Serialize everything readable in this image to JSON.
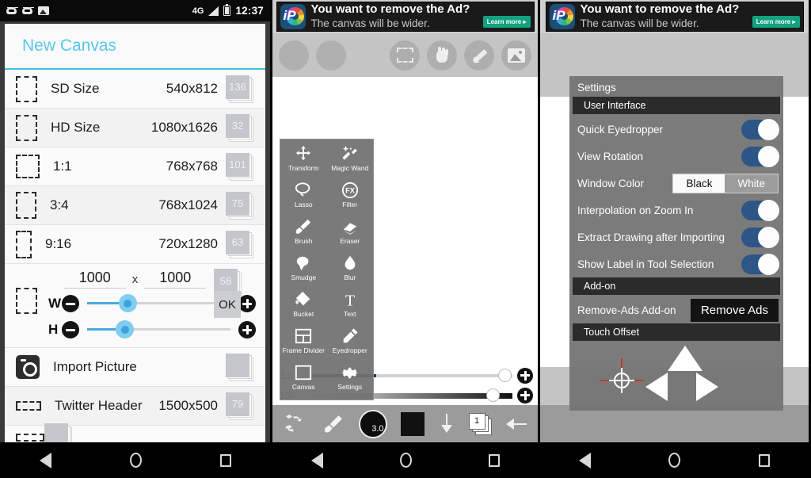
{
  "statusbar": {
    "network": "4G",
    "time": "12:37"
  },
  "panel1": {
    "title": "New Canvas",
    "presets": [
      {
        "label": "SD Size",
        "dim": "540x812",
        "count": "136",
        "shape": "sd"
      },
      {
        "label": "HD Size",
        "dim": "1080x1626",
        "count": "32",
        "shape": "hd"
      },
      {
        "label": "1:1",
        "dim": "768x768",
        "count": "101",
        "shape": "sq"
      },
      {
        "label": "3:4",
        "dim": "768x1024",
        "count": "75",
        "shape": "p34"
      },
      {
        "label": "9:16",
        "dim": "720x1280",
        "count": "63",
        "shape": "p916"
      }
    ],
    "custom": {
      "width_value": "1000",
      "height_value": "1000",
      "separator": "x",
      "w_label": "W",
      "h_label": "H",
      "count": "58",
      "ok_label": "OK",
      "minus_label": "minus-button",
      "plus_label": "plus-button"
    },
    "after": [
      {
        "label": "Import Picture",
        "dim": "",
        "count": "",
        "shape": "camera"
      },
      {
        "label": "Twitter Header",
        "dim": "1500x500",
        "count": "79",
        "shape": "wide"
      }
    ]
  },
  "ad": {
    "headline": "You want to remove the Ad?",
    "subline": "The canvas will be wider.",
    "button": "Learn more ▸",
    "logo_text": "iP"
  },
  "panel2": {
    "toolbar_icons": [
      "blank-circle",
      "blank-circle",
      "selection-icon",
      "hand-icon",
      "pencil-icon",
      "image-icon"
    ],
    "tools": [
      {
        "label": "Transform",
        "icon": "transform-icon"
      },
      {
        "label": "Magic Wand",
        "icon": "magic-wand-icon"
      },
      {
        "label": "Lasso",
        "icon": "lasso-icon"
      },
      {
        "label": "Filter",
        "icon": "filter-fx-icon"
      },
      {
        "label": "Brush",
        "icon": "brush-icon"
      },
      {
        "label": "Eraser",
        "icon": "eraser-icon"
      },
      {
        "label": "Smudge",
        "icon": "smudge-icon"
      },
      {
        "label": "Blur",
        "icon": "blur-drop-icon"
      },
      {
        "label": "Bucket",
        "icon": "bucket-icon"
      },
      {
        "label": "Text",
        "icon": "text-t-icon"
      },
      {
        "label": "Frame Divider",
        "icon": "frame-divider-icon"
      },
      {
        "label": "Eyedropper",
        "icon": "eyedropper-icon"
      },
      {
        "label": "Canvas",
        "icon": "canvas-icon"
      },
      {
        "label": "Settings",
        "icon": "gear-icon"
      }
    ],
    "sliders": [
      {
        "value": "3.0"
      },
      {
        "value": "100"
      }
    ],
    "bottombar": {
      "brush_size": "3.0",
      "layer_count": "1"
    }
  },
  "panel3": {
    "title": "Settings",
    "sections": [
      {
        "header": "User Interface",
        "rows": [
          {
            "label": "Quick Eyedropper",
            "control": "toggle",
            "value": "on"
          },
          {
            "label": "View Rotation",
            "control": "toggle",
            "value": "on"
          },
          {
            "label": "Window Color",
            "control": "segmented",
            "options": [
              "Black",
              "White"
            ],
            "selected": "Black"
          },
          {
            "label": "Interpolation on Zoom In",
            "control": "toggle",
            "value": "on"
          },
          {
            "label": "Extract Drawing after Importing",
            "control": "toggle",
            "value": "on"
          },
          {
            "label": "Show Label in Tool Selection",
            "control": "toggle",
            "value": "on"
          }
        ]
      },
      {
        "header": "Add-on",
        "rows": [
          {
            "label": "Remove-Ads Add-on",
            "control": "button",
            "button_label": "Remove Ads"
          }
        ]
      },
      {
        "header": "Touch Offset",
        "rows": []
      }
    ]
  }
}
